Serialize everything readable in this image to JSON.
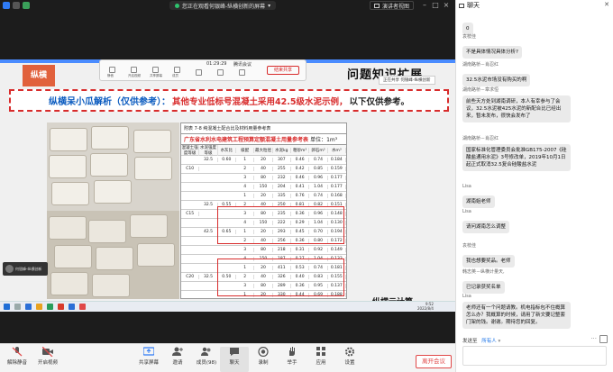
{
  "topbar": {
    "screen_title": "您正在观看何银峰-纵横创新的屏幕",
    "view_button": "演讲者视图"
  },
  "toolbar_popup": {
    "time": "01:29:29",
    "host": "腾讯会议",
    "labels": [
      "静音",
      "开启视频",
      "共享屏幕",
      "成员",
      "聊天",
      "录制",
      "应用",
      "设置"
    ],
    "end_label": "结束共享"
  },
  "recording_badge": "正在共享 何银峰-纵横创新",
  "slide": {
    "logo": "纵横",
    "heading": "问题知识扩展",
    "banner_prefix": "纵横呆小瓜解析（仅供参考）：",
    "banner_red": "其他专业低标号混凝土采用42.5级水泥示例，",
    "banner_tail": "以下仅供参考。",
    "table_caption": "附表 7-8    纯混凝土配合比及材料用量参考表",
    "table_subcaption": "广东省水利水电建筑工程预算定额混凝土用量参考表",
    "table_unit": "单位：1m³",
    "table_header": [
      "混凝土强度等级",
      "水泥强度等级",
      "水灰比",
      "级配",
      "最大粒径",
      "水泥kg",
      "粗砂m³",
      "卵石m³",
      "水m³"
    ],
    "table_rows": [
      [
        "",
        "32.5",
        "0.60",
        "1",
        "20",
        "307",
        "0.46",
        "0.74",
        "0.184"
      ],
      [
        "C10",
        "",
        "",
        "2",
        "40",
        "255",
        "0.42",
        "0.85",
        "0.159"
      ],
      [
        "",
        "",
        "",
        "3",
        "80",
        "232",
        "0.46",
        "0.96",
        "0.177"
      ],
      [
        "",
        "",
        "",
        "4",
        "150",
        "204",
        "0.41",
        "1.04",
        "0.177"
      ],
      [
        "",
        "",
        "",
        "1",
        "20",
        "335",
        "0.76",
        "0.74",
        "0.168"
      ],
      [
        "",
        "32.5",
        "0.55",
        "2",
        "40",
        "250",
        "0.81",
        "0.82",
        "0.151"
      ],
      [
        "C15",
        "",
        "",
        "3",
        "80",
        "235",
        "0.36",
        "0.96",
        "0.148"
      ],
      [
        "",
        "",
        "",
        "4",
        "150",
        "222",
        "0.29",
        "1.04",
        "0.130"
      ],
      [
        "",
        "42.5",
        "0.65",
        "1",
        "20",
        "293",
        "0.45",
        "0.70",
        "0.194"
      ],
      [
        "",
        "",
        "",
        "2",
        "40",
        "256",
        "0.36",
        "0.80",
        "0.172"
      ],
      [
        "",
        "",
        "",
        "3",
        "80",
        "218",
        "0.31",
        "0.92",
        "0.149"
      ],
      [
        "",
        "",
        "",
        "4",
        "150",
        "187",
        "0.27",
        "1.04",
        "0.133"
      ],
      [
        "",
        "",
        "",
        "1",
        "20",
        "411",
        "0.53",
        "0.74",
        "0.181"
      ],
      [
        "C20",
        "32.5",
        "0.50",
        "2",
        "40",
        "326",
        "0.40",
        "0.83",
        "0.155"
      ],
      [
        "",
        "",
        "",
        "3",
        "80",
        "289",
        "0.36",
        "0.95",
        "0.137"
      ],
      [
        "",
        "",
        "",
        "1",
        "20",
        "330",
        "0.44",
        "0.69",
        "0.188"
      ],
      [
        "",
        "42.5",
        "0.60",
        "2",
        "40",
        "292",
        "0.37",
        "0.79",
        "0.172"
      ],
      [
        "",
        "",
        "",
        "3",
        "80",
        "260",
        "0.32",
        "0.93",
        "0.147"
      ]
    ],
    "footer_brand": "纵横云计算"
  },
  "self_video": {
    "label": "何银峰-纵横创新"
  },
  "taskbar": {
    "time": "9:52",
    "date": "2022/8/4"
  },
  "bottom_toolbar": {
    "mute": "解除静音",
    "video": "开启视频",
    "share": "共享屏幕",
    "invite": "邀请",
    "members": "成员(98)",
    "chat": "聊天",
    "record": "录制",
    "raise_hand": "举手",
    "apps": "应用",
    "settings": "设置",
    "end_meeting": "离开会议"
  },
  "chat": {
    "title": "聊天",
    "messages": [
      {
        "sender": "",
        "text": "0"
      },
      {
        "sender": "袁枝佳",
        "text": "不是具体情况具体分析?"
      },
      {
        "sender": "湖南路桥－肖忍红",
        "text": "32.5水泥市场没有购买的啊"
      },
      {
        "sender": "湖南路桥－章求恒",
        "text": "前些天方处到湖南调研，本人有幸参与了会议，32.5水泥被425水泥的新配合比已经出来，暂未发布，很快会发布了"
      },
      {
        "sender": "湖南路桥－肖忍红",
        "text": "国家标准化管理委员会批准GB175-2007《硅酸盐通用水泥》3号修改单，2019年10月1日起正式取消32.5复合硅酸盐水泥"
      },
      {
        "sender": "Lisa",
        "text": "湖南姐老师"
      },
      {
        "sender": "Lisa",
        "text": "请问湖南怎么调整"
      },
      {
        "sender": "袁枝佳",
        "text": "我也想要奖品。老师"
      },
      {
        "sender": "韩志英－纵横计量天,",
        "text": "已记录获奖名单"
      },
      {
        "sender": "Lisa",
        "text": "老师还有一个问题请教。机电指标包不住概算怎么办？我概算的时候，请用了新文要记整套门架的钱。谢谢。期待您的回复。"
      }
    ],
    "send_to_label": "发送至",
    "send_to_value": "所有人"
  },
  "colors": {
    "accent_red": "#d82c2c",
    "brand_orange": "#e1613c",
    "blue": "#0b5bbf"
  }
}
